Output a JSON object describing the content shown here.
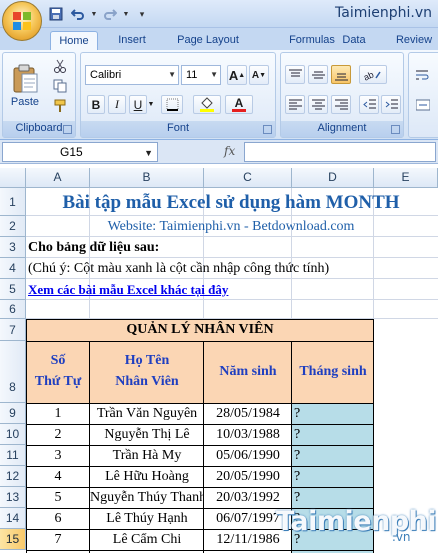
{
  "brand": "Taimienphi.vn",
  "tabs": [
    {
      "label": "Home",
      "active": true
    },
    {
      "label": "Insert"
    },
    {
      "label": "Page Layout"
    },
    {
      "label": "Formulas"
    },
    {
      "label": "Data"
    },
    {
      "label": "Review"
    }
  ],
  "ribbon": {
    "clipboard": {
      "label": "Clipboard",
      "paste": "Paste"
    },
    "font": {
      "label": "Font",
      "name": "Calibri",
      "size": "11",
      "grow": "A",
      "shrink": "A",
      "bold": "B",
      "italic": "I",
      "underline": "U",
      "color_letter": "A"
    },
    "alignment": {
      "label": "Alignment"
    }
  },
  "formula_bar": {
    "name_box": "G15",
    "fx": "fx",
    "value": ""
  },
  "columns": [
    "A",
    "B",
    "C",
    "D",
    "E"
  ],
  "rows": [
    "1",
    "2",
    "3",
    "4",
    "5",
    "6",
    "7",
    "8",
    "9",
    "10",
    "11",
    "12",
    "13",
    "14",
    "15"
  ],
  "selected_row": "15",
  "sheet": {
    "title": "Bài tập mẫu Excel sử dụng hàm MONTH",
    "website": "Website: Taimienphi.vn - Betdownload.com",
    "prompt": "Cho bảng dữ liệu sau:",
    "note": "(Chú ý: Cột màu xanh là cột cần nhập công thức tính)",
    "link": "Xem các bài mẫu Excel khác tại đây",
    "table_title": "QUẢN LÝ NHÂN VIÊN",
    "headers": {
      "stt_line1": "Số",
      "stt_line2": "Thứ Tự",
      "name_line1": "Họ Tên",
      "name_line2": "Nhân Viên",
      "dob": "Năm sinh",
      "month": "Tháng sinh"
    },
    "records": [
      {
        "stt": "1",
        "name": "Trần Văn Nguyên",
        "dob": "28/05/1984",
        "month": "?"
      },
      {
        "stt": "2",
        "name": "Nguyễn Thị Lê",
        "dob": "10/03/1988",
        "month": "?"
      },
      {
        "stt": "3",
        "name": "Trần Hà My",
        "dob": "05/06/1990",
        "month": "?"
      },
      {
        "stt": "4",
        "name": "Lê Hữu Hoàng",
        "dob": "20/05/1990",
        "month": "?"
      },
      {
        "stt": "5",
        "name": "Nguyễn Thúy Thanh",
        "dob": "20/03/1992",
        "month": "?"
      },
      {
        "stt": "6",
        "name": "Lê Thúy Hạnh",
        "dob": "06/07/1997",
        "month": "?"
      },
      {
        "stt": "7",
        "name": "Lê Cẩm Chi",
        "dob": "12/11/1986",
        "month": "?"
      }
    ]
  },
  "watermark": {
    "main": "Taimienphi",
    "suffix": ".vn"
  },
  "colors": {
    "title": "#1f5fa9",
    "header_fill": "#fbd6b4",
    "month_fill": "#b7dde8",
    "link": "#0000ee"
  }
}
